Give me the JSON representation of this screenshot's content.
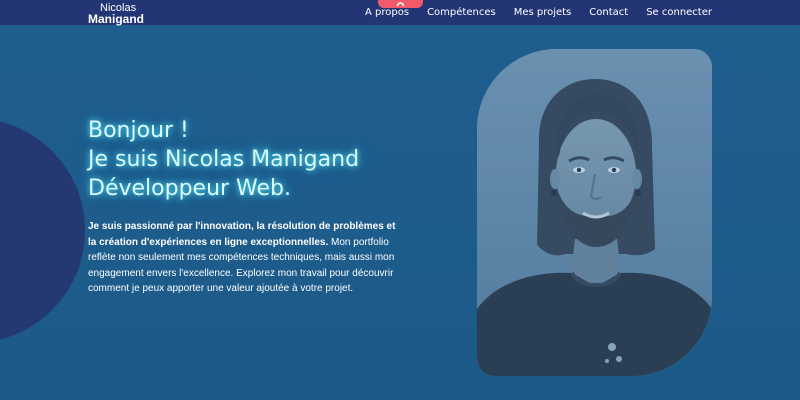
{
  "navbar": {
    "brand_first": "Nicolas",
    "brand_last": "Manigand",
    "links": [
      "A propos",
      "Compétences",
      "Mes projets",
      "Contact",
      "Se connecter"
    ]
  },
  "hero": {
    "greeting": "Bonjour !",
    "intro_line": "Je suis Nicolas Manigand",
    "role": "Développeur Web.",
    "description_bold": "Je suis passionné par l'innovation, la résolution de problèmes et la création d'expériences en ligne exceptionnelles.",
    "description_rest": " Mon portfolio reflète non seulement mes compétences techniques, mais aussi mon engagement envers l'excellence. Explorez mon travail pour découvrir comment je peux apporter une valeur ajoutée à votre projet."
  },
  "icons": {
    "pull_tab": "arc-icon",
    "photo": "profile-photo"
  },
  "colors": {
    "background": "#1d5a8a",
    "navbar": "#233575",
    "accent_tab": "#f05a6a",
    "heading_glow": "#5af0ff",
    "circle": "#243872"
  }
}
